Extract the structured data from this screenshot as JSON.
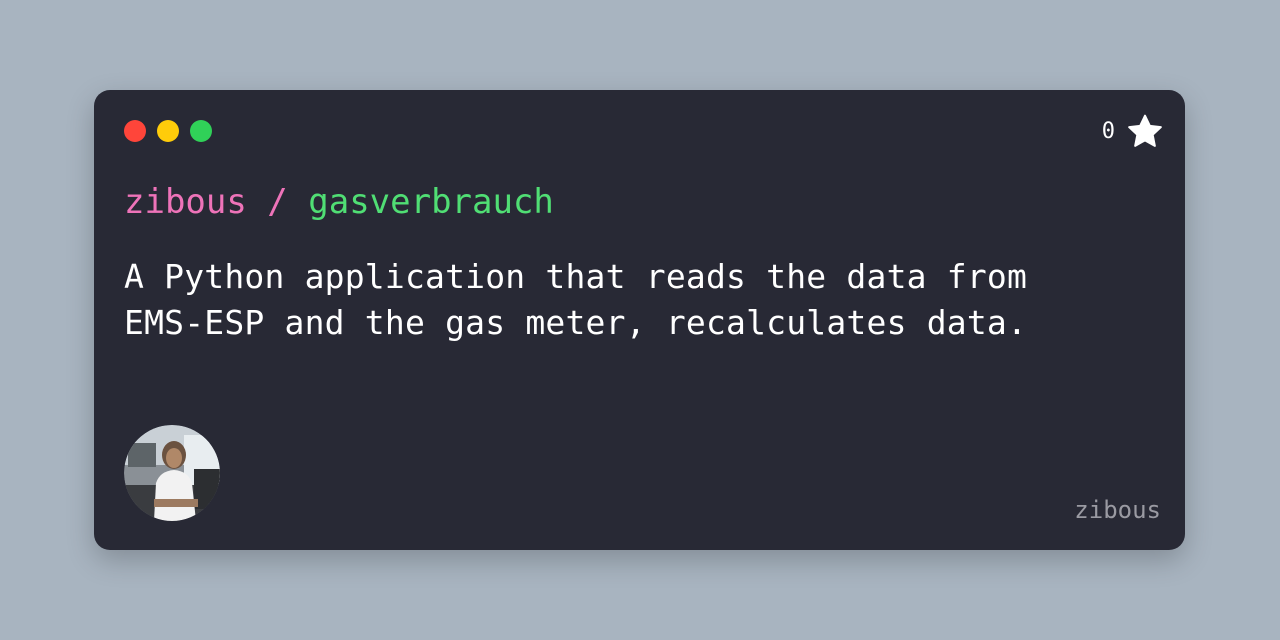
{
  "window": {
    "controls": [
      {
        "name": "close",
        "color": "#ff453a"
      },
      {
        "name": "minimize",
        "color": "#ffcc0a"
      },
      {
        "name": "maximize",
        "color": "#30d158"
      }
    ]
  },
  "stars": {
    "count": "0",
    "icon": "star-icon"
  },
  "repo": {
    "owner": "zibous",
    "separator": " / ",
    "name": "gasverbrauch"
  },
  "description": "A Python application that reads the data from EMS-ESP and the gas meter, recalculates data.",
  "author": {
    "name": "zibous",
    "avatar_icon": "user-avatar"
  },
  "colors": {
    "background": "#a8b4c0",
    "card": "#282935",
    "owner": "#ee73b9",
    "repo_name": "#50de74",
    "text": "#ffffff",
    "muted": "#9a9aa2"
  }
}
